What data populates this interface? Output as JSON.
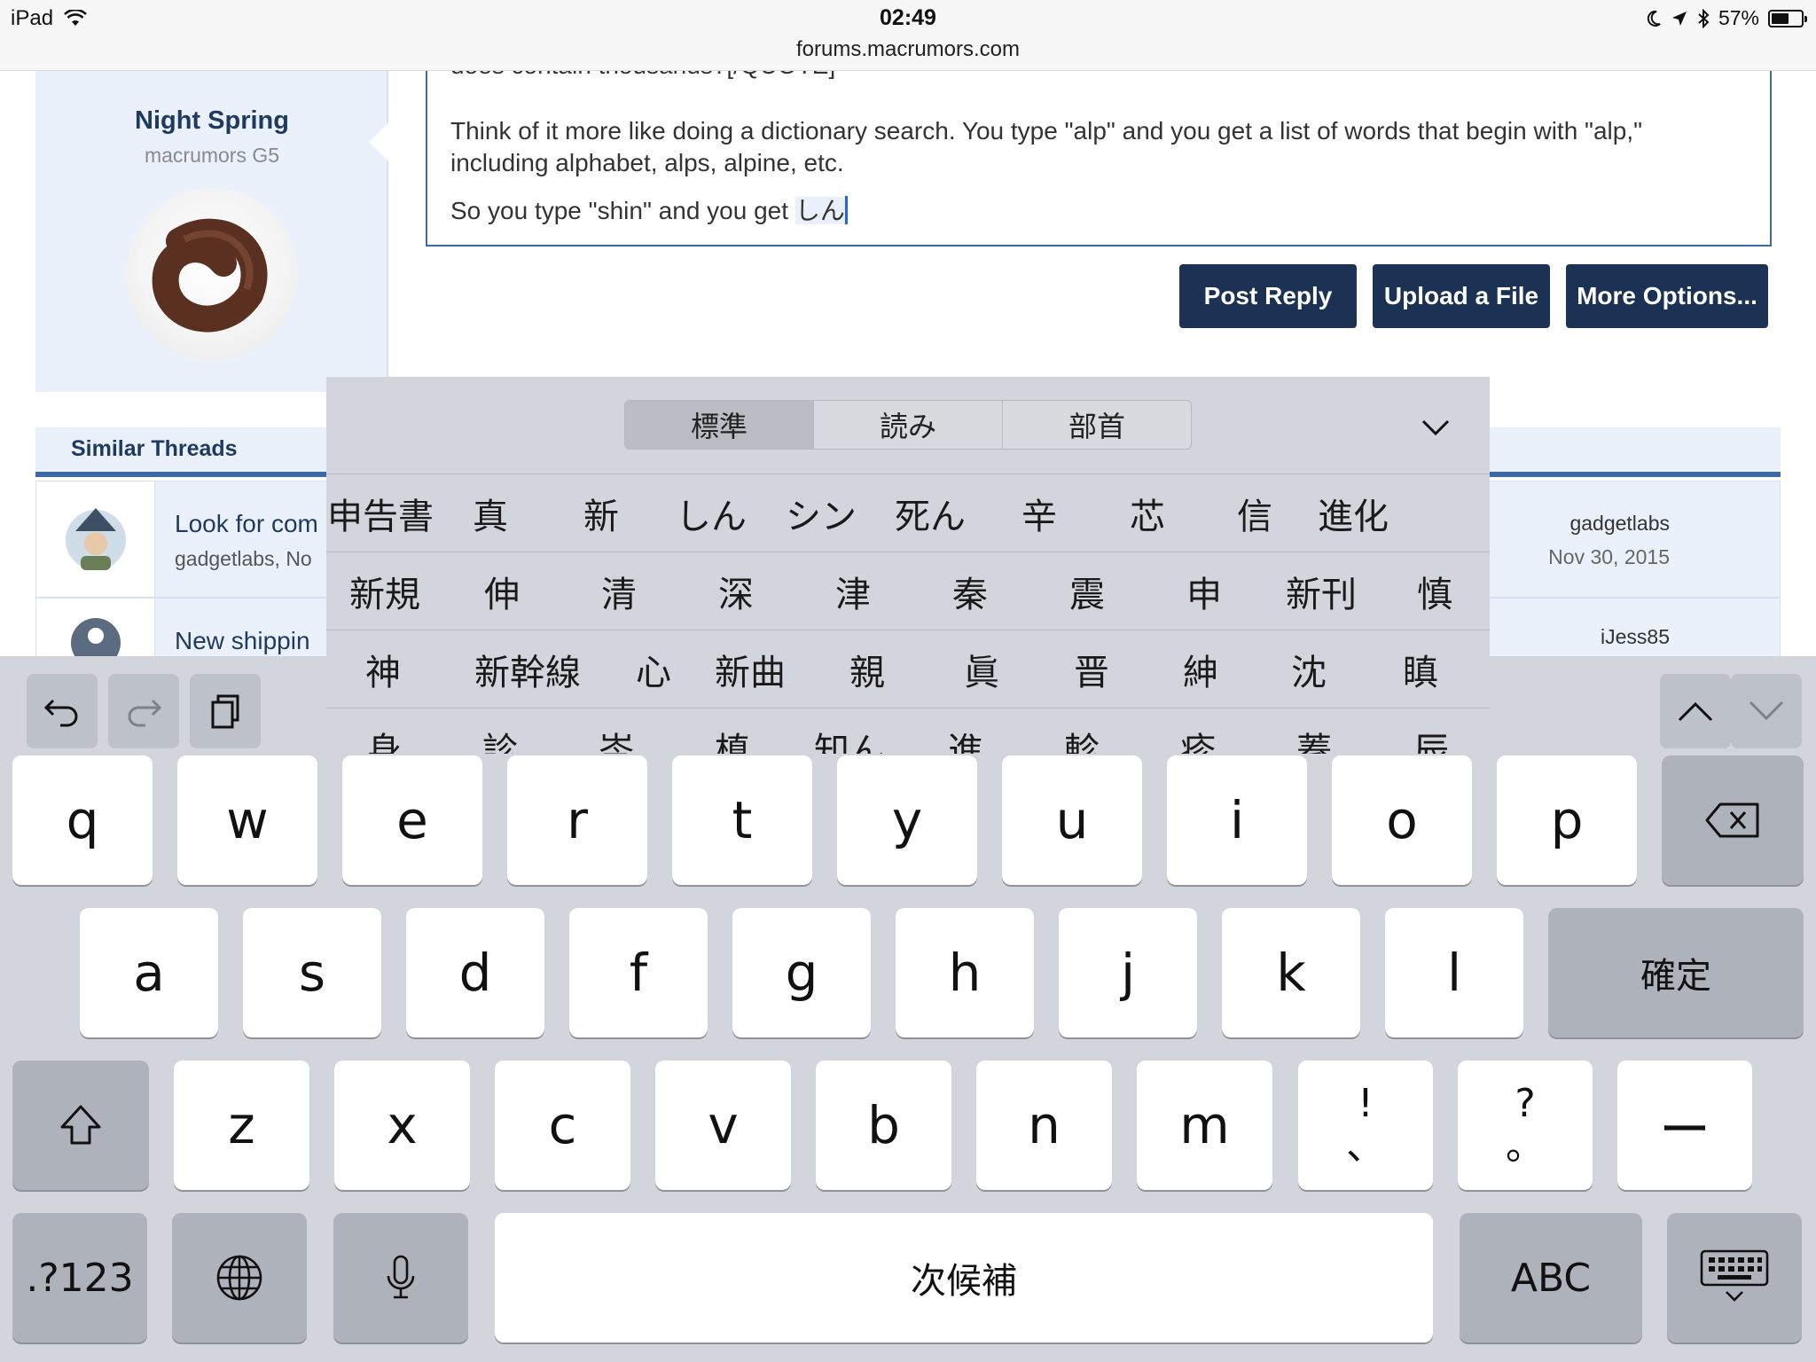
{
  "status_bar": {
    "device": "iPad",
    "time": "02:49",
    "url": "forums.macrumors.com",
    "battery": "57%",
    "battery_level": 0.57
  },
  "post": {
    "user_name": "Night Spring",
    "user_title": "macrumors G5",
    "cut_line": "does contain thousands?[/QUOTE]",
    "para1": "Think of it more like doing a dictionary search. You type \"alp\" and you get a list of words that begin with \"alp,\" including alphabet, alps, alpine, etc.",
    "para2_prefix": "So you type \"shin\" and you get ",
    "para2_marked": "しん"
  },
  "buttons": {
    "post_reply": "Post Reply",
    "upload": "Upload a File",
    "more": "More Options..."
  },
  "similar": {
    "header": "Similar Threads",
    "threads": [
      {
        "title": "Look for com",
        "meta": "gadgetlabs, No",
        "last_by": "gadgetlabs",
        "last_date": "Nov 30, 2015"
      },
      {
        "title": "New shippin",
        "meta": "",
        "last_by": "iJess85",
        "last_date": ""
      }
    ]
  },
  "candidates": {
    "tabs": [
      "標準",
      "読み",
      "部首"
    ],
    "active_tab": 0,
    "rows": [
      [
        "申告書",
        "真",
        "新",
        "しん",
        "シン",
        "死ん",
        "辛",
        "芯",
        "信",
        "進化"
      ],
      [
        "新規",
        "伸",
        "清",
        "深",
        "津",
        "秦",
        "震",
        "申",
        "新刊",
        "慎"
      ],
      [
        "神",
        "新幹線",
        "心",
        "新曲",
        "親",
        "眞",
        "晋",
        "紳",
        "沈",
        "瞋"
      ],
      [
        "身",
        "診",
        "岑",
        "槙",
        "知ん",
        "進",
        "軫",
        "疹",
        "蓁",
        "辰"
      ]
    ]
  },
  "keyboard": {
    "row1": [
      "q",
      "w",
      "e",
      "r",
      "t",
      "y",
      "u",
      "i",
      "o",
      "p"
    ],
    "row2": [
      "a",
      "s",
      "d",
      "f",
      "g",
      "h",
      "j",
      "k",
      "l"
    ],
    "row3": [
      "z",
      "x",
      "c",
      "v",
      "b",
      "n",
      "m"
    ],
    "confirm": "確定",
    "excl_top": "!",
    "excl_bottom": "、",
    "q_top": "?",
    "q_bottom": "。",
    "dash": "ー",
    "numbers": ".?123",
    "space": "次候補",
    "abc": "ABC"
  }
}
